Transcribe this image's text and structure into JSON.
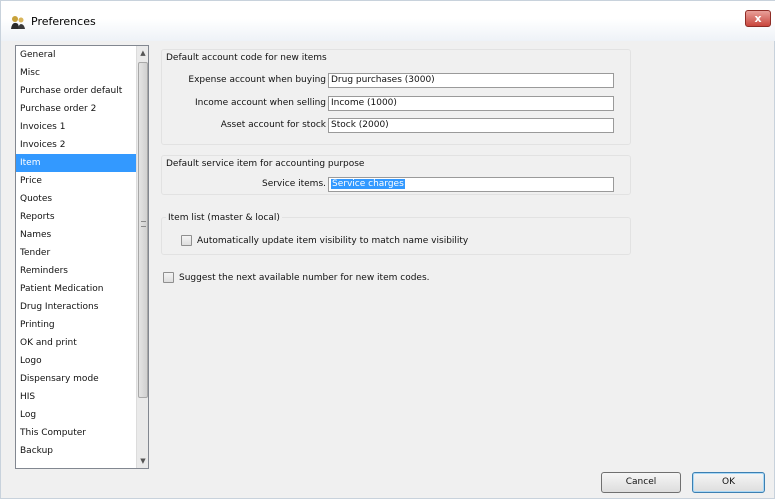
{
  "window": {
    "title": "Preferences",
    "close_label": "x"
  },
  "sidebar": {
    "items": [
      {
        "label": "General"
      },
      {
        "label": "Misc"
      },
      {
        "label": "Purchase order default"
      },
      {
        "label": "Purchase order 2"
      },
      {
        "label": "Invoices 1"
      },
      {
        "label": "Invoices 2"
      },
      {
        "label": "Item",
        "selected": true
      },
      {
        "label": "Price"
      },
      {
        "label": "Quotes"
      },
      {
        "label": "Reports"
      },
      {
        "label": "Names"
      },
      {
        "label": "Tender"
      },
      {
        "label": "Reminders"
      },
      {
        "label": "Patient Medication"
      },
      {
        "label": "Drug Interactions"
      },
      {
        "label": "Printing"
      },
      {
        "label": "OK and print"
      },
      {
        "label": "Logo"
      },
      {
        "label": "Dispensary mode"
      },
      {
        "label": "HIS"
      },
      {
        "label": "Log"
      },
      {
        "label": "This Computer"
      },
      {
        "label": "Backup"
      }
    ],
    "scroll_up": "▲",
    "scroll_down": "▼"
  },
  "accounts": {
    "title": "Default account code for new items",
    "expense_label": "Expense account when buying",
    "expense_value": "Drug purchases (3000)",
    "income_label": "Income account when selling",
    "income_value": "Income (1000)",
    "asset_label": "Asset account for stock",
    "asset_value": "Stock (2000)"
  },
  "service": {
    "title": "Default service item for accounting purpose",
    "label": "Service items.",
    "value": "Service charges"
  },
  "item_list": {
    "title": "Item list (master & local)",
    "checkbox_label": "Automatically update item visibility to match name visibility",
    "checked": false
  },
  "suggest": {
    "label": "Suggest the next available number for new item codes.",
    "checked": false
  },
  "buttons": {
    "cancel": "Cancel",
    "ok": "OK"
  }
}
